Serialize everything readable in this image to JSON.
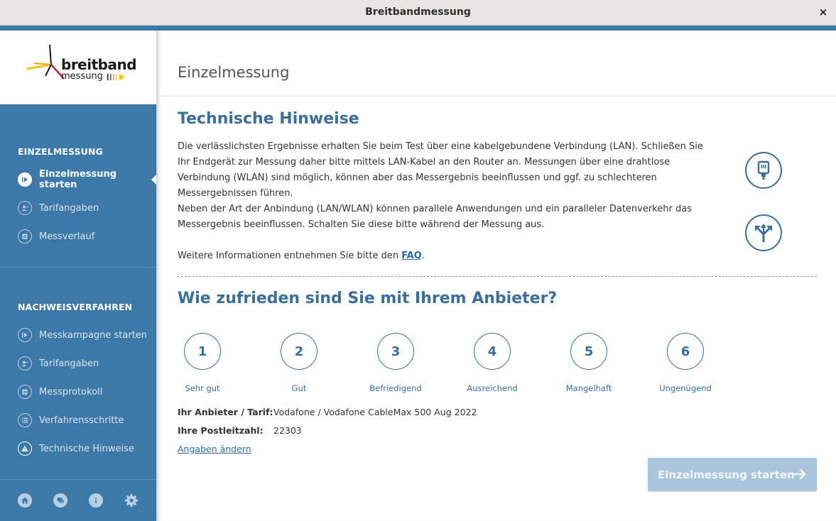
{
  "window": {
    "title": "Breitbandmessung",
    "close_glyph": "×"
  },
  "logo": {
    "line1": "breitband",
    "line2": "messung"
  },
  "sidebar": {
    "section1": "EINZELMESSUNG",
    "items1": [
      {
        "label": "Einzelmessung starten",
        "icon": "play-icon"
      },
      {
        "label": "Tarifangaben",
        "icon": "person-icon"
      },
      {
        "label": "Messverlauf",
        "icon": "calendar-icon"
      }
    ],
    "section2": "NACHWEISVERFAHREN",
    "items2": [
      {
        "label": "Messkampagne starten",
        "icon": "play-icon"
      },
      {
        "label": "Tarifangaben",
        "icon": "person-icon"
      },
      {
        "label": "Messprotokoll",
        "icon": "calendar-icon"
      },
      {
        "label": "Verfahrensschritte",
        "icon": "list-icon"
      },
      {
        "label": "Technische Hinweise",
        "icon": "warning-icon"
      }
    ],
    "bottom_icons": [
      "home-icon",
      "chat-icon",
      "info-icon",
      "gear-icon"
    ]
  },
  "main": {
    "page_title": "Einzelmessung",
    "tech_heading": "Technische Hinweise",
    "para1": "Die verlässlichsten Ergebnisse erhalten Sie beim Test über eine kabelgebundene Verbindung (LAN). Schließen Sie Ihr Endgerät zur Messung daher bitte mittels LAN-Kabel an den Router an. Messungen über eine drahtlose Verbindung (WLAN) sind möglich, können aber das Messergebnis beeinflussen und ggf. zu schlechteren Messergebnissen führen.",
    "para2": "Neben der Art der Anbindung (LAN/WLAN) können parallele Anwendungen und ein paralleler Datenverkehr das Messergebnis beeinflussen. Schalten Sie diese bitte während der Messung aus.",
    "para3_prefix": "Weitere Informationen entnehmen Sie bitte den ",
    "para3_link": "FAQ",
    "para3_suffix": ".",
    "satisfaction_heading": "Wie zufrieden sind Sie mit Ihrem Anbieter?",
    "ratings": [
      {
        "value": "1",
        "label": "Sehr gut"
      },
      {
        "value": "2",
        "label": "Gut"
      },
      {
        "value": "3",
        "label": "Befriedigend"
      },
      {
        "value": "4",
        "label": "Ausreichend"
      },
      {
        "value": "5",
        "label": "Mangelhaft"
      },
      {
        "value": "6",
        "label": "Ungenügend"
      }
    ],
    "provider_key": "Ihr Anbieter / Tarif:",
    "provider_value": "Vodafone / Vodafone CableMax 500 Aug 2022",
    "postcode_key": "Ihre Postleitzahl:",
    "postcode_value": "22303",
    "change_link": "Angaben ändern",
    "start_button": "Einzelmessung starten"
  },
  "colors": {
    "accent": "#3d79a8",
    "heading": "#3b6f98",
    "button_disabled": "#a9c4db"
  }
}
